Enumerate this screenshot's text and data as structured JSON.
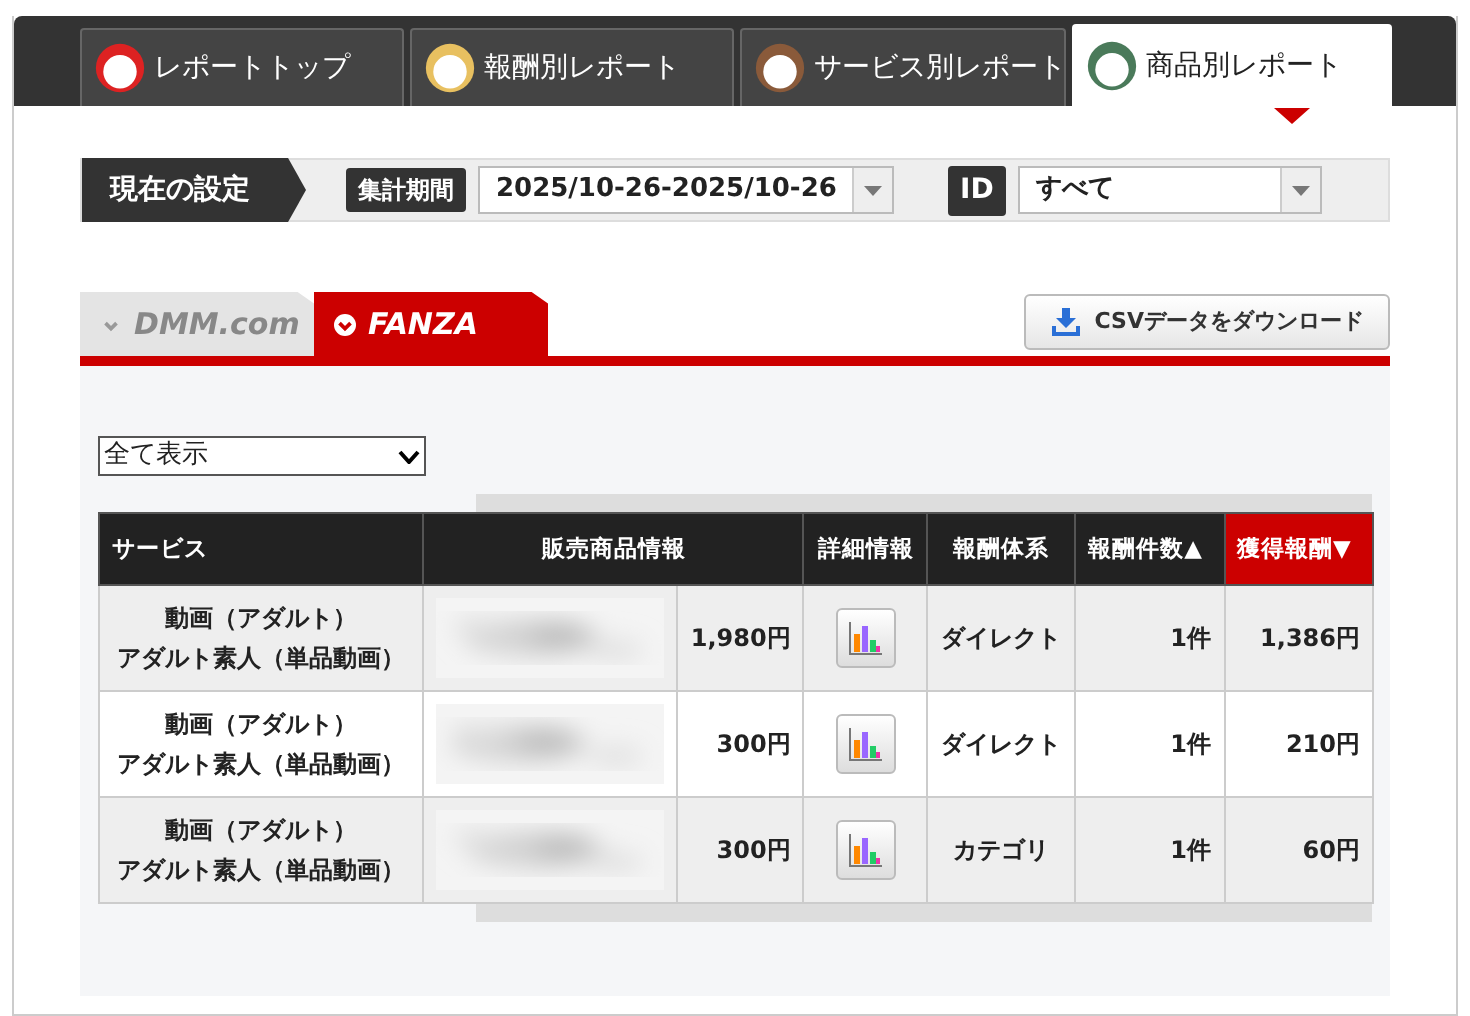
{
  "report_tabs": [
    {
      "label": "レポートトップ",
      "selected": false
    },
    {
      "label": "報酬別レポート",
      "selected": false
    },
    {
      "label": "サービス別レポート",
      "selected": false
    },
    {
      "label": "商品別レポート",
      "selected": true
    }
  ],
  "settings": {
    "heading": "現在の設定",
    "period_label": "集計期間",
    "period_value": "2025/10-26-2025/10-26",
    "id_label": "ID",
    "id_value": "すべて"
  },
  "brand_tabs": [
    {
      "label": "DMM.com",
      "selected": false
    },
    {
      "label": "FANZA",
      "selected": true
    }
  ],
  "download_button": "CSVデータをダウンロード",
  "filter": {
    "value": "全て表示"
  },
  "table": {
    "columns": [
      {
        "label": "サービス",
        "selected": false
      },
      {
        "label": "販売商品情報",
        "selected": false
      },
      {
        "label": "詳細情報",
        "selected": false
      },
      {
        "label": "報酬体系",
        "selected": false
      },
      {
        "label": "報酬件数▲",
        "selected": false
      },
      {
        "label": "獲得報酬▼",
        "selected": true
      }
    ],
    "rows": [
      {
        "service": [
          "動画（アダルト）",
          "アダルト素人（単品動画）"
        ],
        "product": {
          "kind": "picture"
        },
        "price": "1,980円",
        "type": "ダイレクト",
        "count": "1件",
        "reward": "1,386円"
      },
      {
        "service": [
          "動画（アダルト）",
          "アダルト素人（単品動画）"
        ],
        "product": {
          "kind": "picture"
        },
        "price": "300円",
        "type": "ダイレクト",
        "count": "1件",
        "reward": "210円"
      },
      {
        "service": [
          "動画（アダルト）",
          "アダルト素人（単品動画）"
        ],
        "product": {
          "kind": "picture"
        },
        "price": "300円",
        "type": "カテゴリ",
        "count": "1件",
        "reward": "60円"
      }
    ]
  }
}
